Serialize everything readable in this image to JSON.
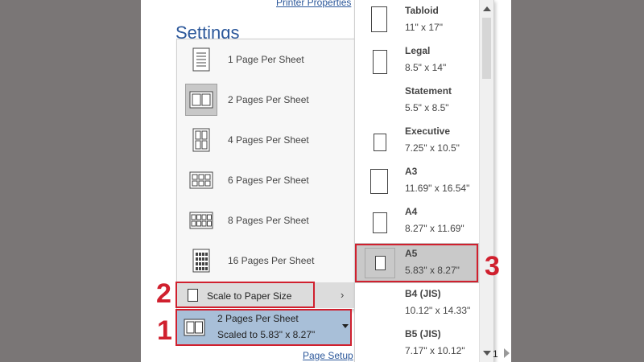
{
  "header": {
    "printer_properties": "Printer Properties",
    "settings_title": "Settings"
  },
  "pages_per_sheet": {
    "items": [
      {
        "label": "1 Page Per Sheet",
        "icon": "one-page-icon"
      },
      {
        "label": "2 Pages Per Sheet",
        "icon": "two-pages-icon",
        "selected": true
      },
      {
        "label": "4 Pages Per Sheet",
        "icon": "four-pages-icon"
      },
      {
        "label": "6 Pages Per Sheet",
        "icon": "six-pages-icon"
      },
      {
        "label": "8 Pages Per Sheet",
        "icon": "eight-pages-icon"
      },
      {
        "label": "16 Pages Per Sheet",
        "icon": "sixteen-pages-icon"
      }
    ],
    "scale_label": "Scale to Paper Size",
    "scale_chevron": "›"
  },
  "selected_combo": {
    "line1": "2 Pages Per Sheet",
    "line2": "Scaled to 5.83\" x 8.27\""
  },
  "paper_sizes": [
    {
      "name": "Tabloid",
      "dims": "11\" x 17\""
    },
    {
      "name": "Legal",
      "dims": "8.5\" x 14\""
    },
    {
      "name": "Statement",
      "dims": "5.5\" x 8.5\""
    },
    {
      "name": "Executive",
      "dims": "7.25\" x 10.5\""
    },
    {
      "name": "A3",
      "dims": "11.69\" x 16.54\""
    },
    {
      "name": "A4",
      "dims": "8.27\" x 11.69\""
    },
    {
      "name": "A5",
      "dims": "5.83\" x 8.27\"",
      "highlighted": true
    },
    {
      "name": "B4 (JIS)",
      "dims": "10.12\" x 14.33\""
    },
    {
      "name": "B5 (JIS)",
      "dims": "7.17\" x 10.12\""
    }
  ],
  "footer": {
    "page_setup": "Page Setup",
    "page_number": "1"
  },
  "annotations": {
    "step1": "1",
    "step2": "2",
    "step3": "3",
    "color": "#d0202e"
  }
}
